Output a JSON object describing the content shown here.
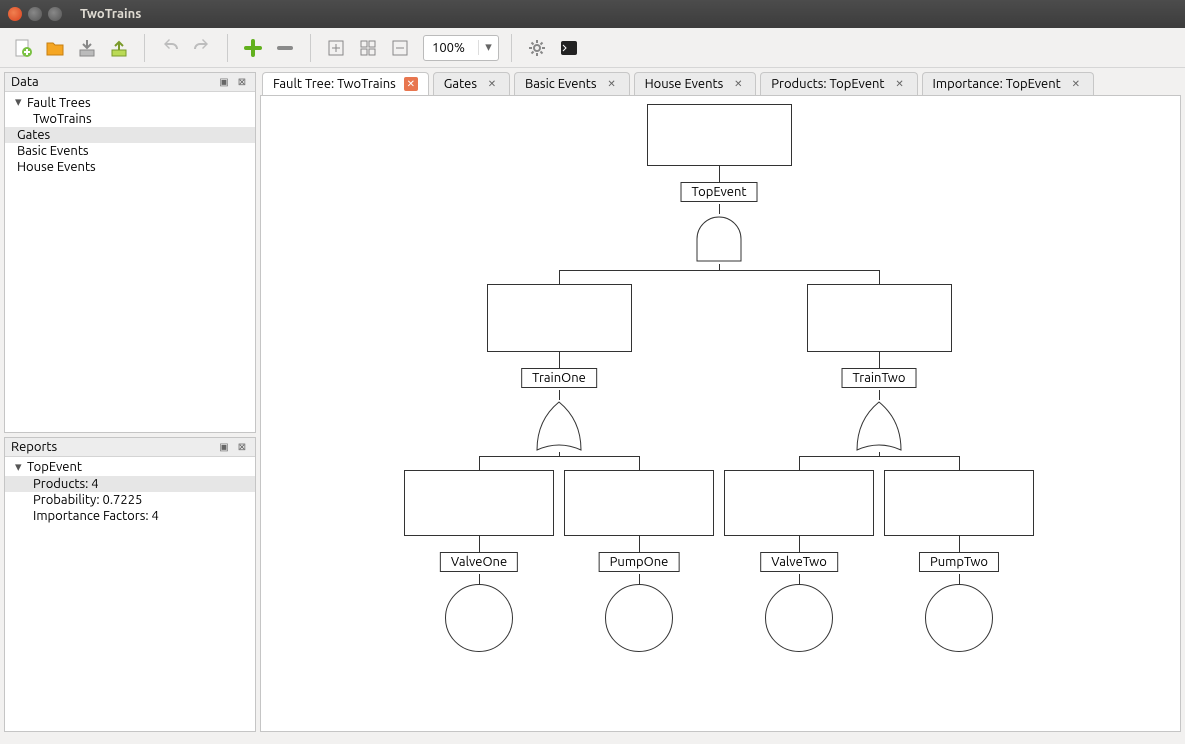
{
  "window": {
    "title": "TwoTrains"
  },
  "toolbar": {
    "zoom": "100%",
    "icons": {
      "new": "new-file-icon",
      "open": "open-folder-icon",
      "saveIn": "import-icon",
      "saveOut": "export-icon",
      "undo": "undo-icon",
      "redo": "redo-icon",
      "add": "plus-icon",
      "remove": "minus-icon",
      "expand": "expand-icon",
      "fit": "fit-icon",
      "collapse": "collapse-icon",
      "settings": "gear-icon",
      "terminal": "terminal-icon"
    }
  },
  "panels": {
    "data": {
      "title": "Data",
      "items": [
        {
          "label": "Fault Trees",
          "expanded": true,
          "children": [
            {
              "label": "TwoTrains"
            }
          ]
        },
        {
          "label": "Gates",
          "selected": true
        },
        {
          "label": "Basic Events"
        },
        {
          "label": "House Events"
        }
      ]
    },
    "reports": {
      "title": "Reports",
      "items": [
        {
          "label": "TopEvent",
          "expanded": true,
          "children": [
            {
              "label": "Products: 4",
              "selected": true
            },
            {
              "label": "Probability: 0.7225"
            },
            {
              "label": "Importance Factors: 4"
            }
          ]
        }
      ]
    }
  },
  "tabs": [
    {
      "label": "Fault Tree: TwoTrains",
      "active": true
    },
    {
      "label": "Gates"
    },
    {
      "label": "Basic Events"
    },
    {
      "label": "House Events"
    },
    {
      "label": "Products: TopEvent"
    },
    {
      "label": "Importance: TopEvent"
    }
  ],
  "faultTree": {
    "top": {
      "name": "TopEvent",
      "gate": "AND"
    },
    "mids": [
      {
        "name": "TrainOne",
        "gate": "OR"
      },
      {
        "name": "TrainTwo",
        "gate": "OR"
      }
    ],
    "leaves": [
      {
        "name": "ValveOne"
      },
      {
        "name": "PumpOne"
      },
      {
        "name": "ValveTwo"
      },
      {
        "name": "PumpTwo"
      }
    ]
  }
}
